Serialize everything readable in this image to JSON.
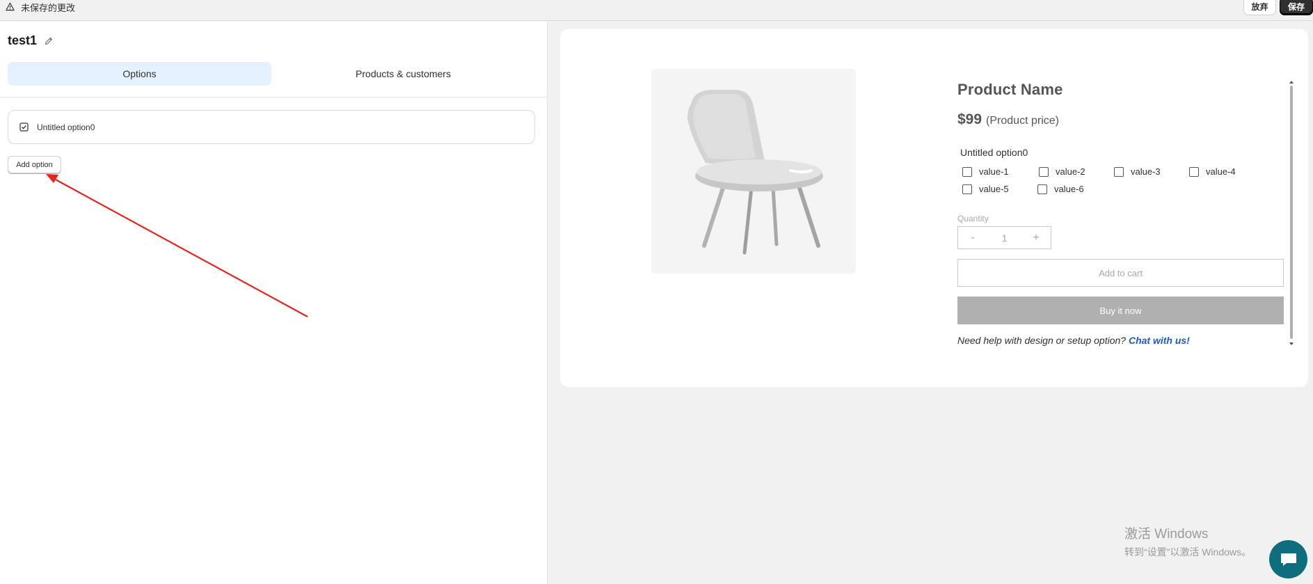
{
  "topbar": {
    "unsaved_text": "未保存的更改",
    "discard_label": "放弃",
    "save_label": "保存"
  },
  "editor": {
    "title": "test1",
    "tabs": [
      {
        "label": "Options",
        "active": true
      },
      {
        "label": "Products & customers",
        "active": false
      }
    ],
    "options": [
      {
        "label": "Untitled option0",
        "icon": "checkbox-icon"
      }
    ],
    "add_option_label": "Add option"
  },
  "preview": {
    "product_name": "Product Name",
    "price": "$99",
    "price_note": "(Product price)",
    "option_label": "Untitled option0",
    "values": [
      "value-1",
      "value-2",
      "value-3",
      "value-4",
      "value-5",
      "value-6"
    ],
    "quantity_label": "Quantity",
    "quantity_minus": "-",
    "quantity_value": "1",
    "quantity_plus": "+",
    "add_to_cart_label": "Add to cart",
    "buy_now_label": "Buy it now",
    "help_text": "Need help with design or setup option?",
    "help_link": "Chat with us!"
  },
  "watermark": {
    "line1": "激活 Windows",
    "line2": "转到“设置”以激活 Windows。"
  },
  "colors": {
    "accent_tab": "#e5f1ff",
    "save_button": "#303030",
    "buy_now": "#b0b0b0",
    "link": "#1a5cc9",
    "chat_bubble": "#0e6e7e",
    "annotation_arrow": "#e8231a"
  }
}
